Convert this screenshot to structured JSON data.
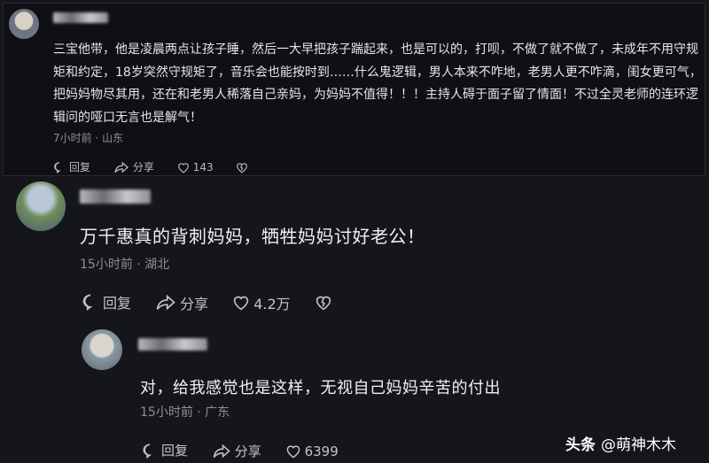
{
  "comment1": {
    "text": "三宝他带，他是凌晨两点让孩子睡，然后一大早把孩子踹起来，也是可以的，打呗，不做了就不做了，未成年不用守规矩和约定，18岁突然守规矩了，音乐会也能按时到……什么鬼逻辑，男人本来不咋地，老男人更不咋滴，闺女更可气，把妈妈物尽其用，还在和老男人稀落自己亲妈，为妈妈不值得！！！主持人碍于面子留了情面！不过全灵老师的连环逻辑问的哑口无言也是解气！",
    "meta": "7小时前 · 山东",
    "reply_label": "回复",
    "share_label": "分享",
    "likes": "143"
  },
  "comment2": {
    "text": "万千惠真的背刺妈妈，牺牲妈妈讨好老公！",
    "meta": "15小时前 · 湖北",
    "reply_label": "回复",
    "share_label": "分享",
    "likes": "4.2万"
  },
  "reply1": {
    "text": "对，给我感觉也是这样，无视自己妈妈辛苦的付出",
    "meta": "15小时前 · 广东",
    "reply_label": "回复",
    "share_label": "分享",
    "likes": "6399"
  },
  "watermark": {
    "brand": "头条",
    "handle": "@萌神木木"
  }
}
